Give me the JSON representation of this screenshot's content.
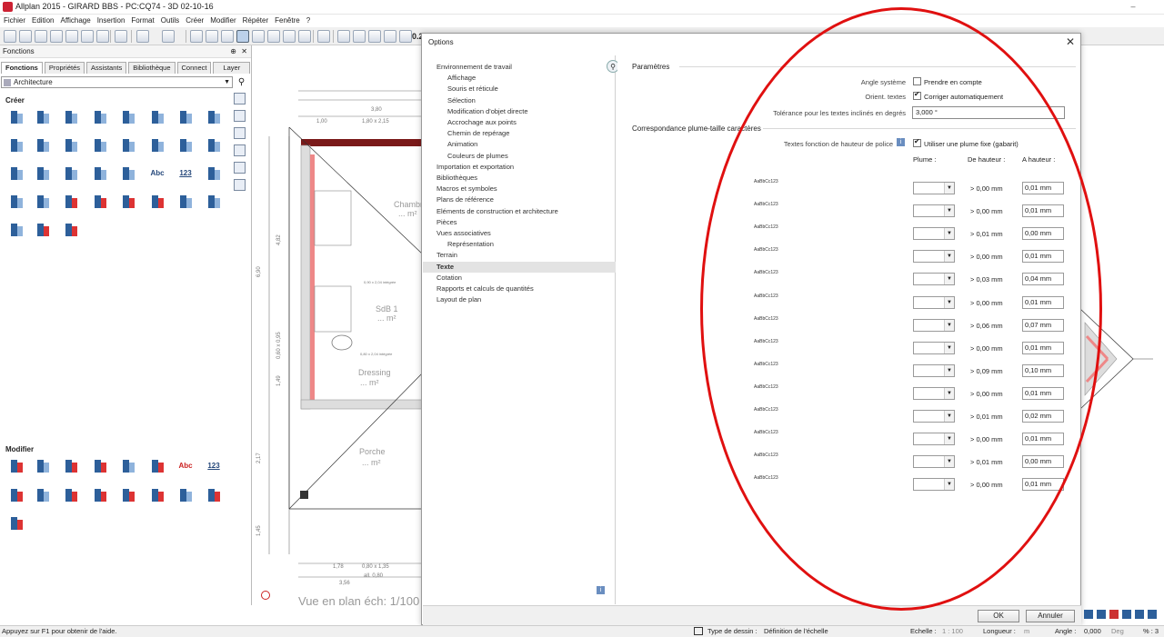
{
  "window": {
    "title": "Allplan 2015 - GIRARD BBS - PC:CQ74 - 3D 02-10-16",
    "minimize": "–"
  },
  "menu": [
    "Fichier",
    "Edition",
    "Affichage",
    "Insertion",
    "Format",
    "Outils",
    "Créer",
    "Modifier",
    "Répéter",
    "Fenêtre",
    "?"
  ],
  "toolbar": {
    "value_partial": "0.2"
  },
  "left_panel": {
    "title": "Fonctions",
    "pin": "⊕",
    "close": "✕",
    "tabs": [
      "Fonctions",
      "Propriétés",
      "Assistants",
      "Bibliothèque",
      "Connect",
      "Layer"
    ],
    "active_tab": "Fonctions",
    "module_select": "Architecture",
    "section_create": "Créer",
    "section_modify": "Modifier",
    "text_tool": "Abc",
    "number_tool": "123"
  },
  "drawing": {
    "dims_top": [
      "3,80",
      "1,00",
      "1,80 x 2,15"
    ],
    "dims_left": [
      "6,90",
      "4,82",
      "0,60 x 0,95",
      "1,49",
      "2,17",
      "1,45"
    ],
    "dims_bottom": [
      "1,78",
      "0,80 x 1,35",
      "all. 0,80",
      "3,56"
    ],
    "rooms": [
      {
        "name": "Chambre",
        "area": "... m²"
      },
      {
        "name": "SdB 1",
        "area": "... m²"
      },
      {
        "name": "Dressing",
        "area": "... m²"
      },
      {
        "name": "Porche",
        "area": "... m²"
      }
    ],
    "door_labels": [
      "0,90 x 2,04 intégrée",
      "0,80 x 2,04 intégrée"
    ],
    "caption": "Vue en plan éch: 1/100"
  },
  "dialog": {
    "title": "Options",
    "close": "✕",
    "tree": [
      {
        "label": "Environnement de travail",
        "level": 0
      },
      {
        "label": "Affichage",
        "level": 1
      },
      {
        "label": "Souris et réticule",
        "level": 1
      },
      {
        "label": "Sélection",
        "level": 1
      },
      {
        "label": "Modification d'objet directe",
        "level": 1
      },
      {
        "label": "Accrochage aux points",
        "level": 1
      },
      {
        "label": "Chemin de repérage",
        "level": 1
      },
      {
        "label": "Animation",
        "level": 1
      },
      {
        "label": "Couleurs de plumes",
        "level": 1
      },
      {
        "label": "Importation et exportation",
        "level": 0
      },
      {
        "label": "Bibliothèques",
        "level": 0
      },
      {
        "label": "Macros et symboles",
        "level": 0
      },
      {
        "label": "Plans de référence",
        "level": 0
      },
      {
        "label": "Eléments de construction et architecture",
        "level": 0
      },
      {
        "label": "Pièces",
        "level": 0
      },
      {
        "label": "Vues associatives",
        "level": 0
      },
      {
        "label": "Représentation",
        "level": 1
      },
      {
        "label": "Terrain",
        "level": 0
      },
      {
        "label": "Texte",
        "level": 0,
        "selected": true
      },
      {
        "label": "Cotation",
        "level": 0
      },
      {
        "label": "Rapports et calculs de quantités",
        "level": 0
      },
      {
        "label": "Layout de plan",
        "level": 0
      }
    ],
    "params": {
      "heading": "Paramètres",
      "system_angle_label": "Angle système",
      "system_angle_check": "Prendre en compte",
      "system_angle_checked": false,
      "orient_label": "Orient. textes",
      "orient_check": "Corriger automatiquement",
      "orient_checked": true,
      "tolerance_label": "Tolérance pour les textes inclinés en degrés",
      "tolerance_value": "3,000 °"
    },
    "pen_map": {
      "heading": "Correspondance plume-taille caractères",
      "font_height_label": "Textes fonction de hauteur de police",
      "fixed_pen_check": "Utiliser une plume fixe (gabarit)",
      "fixed_pen_checked": true,
      "col_pen": "Plume :",
      "col_from": "De hauteur :",
      "col_to": "A hauteur :",
      "rows": [
        {
          "sample": "AaBbCc123",
          "from": "> 0,00 mm",
          "to": "0,01 mm"
        },
        {
          "sample": "AaBbCc123",
          "from": "> 0,00 mm",
          "to": "0,01 mm"
        },
        {
          "sample": "AaBbCc123",
          "from": "> 0,01 mm",
          "to": "0,00 mm"
        },
        {
          "sample": "AaBbCc123",
          "from": "> 0,00 mm",
          "to": "0,01 mm"
        },
        {
          "sample": "AaBbCc123",
          "from": "> 0,03 mm",
          "to": "0,04 mm"
        },
        {
          "sample": "AaBbCc123",
          "from": "> 0,00 mm",
          "to": "0,01 mm"
        },
        {
          "sample": "AaBbCc123",
          "from": "> 0,06 mm",
          "to": "0,07 mm"
        },
        {
          "sample": "AaBbCc123",
          "from": "> 0,00 mm",
          "to": "0,01 mm"
        },
        {
          "sample": "AaBbCc123",
          "from": "> 0,09 mm",
          "to": "0,10 mm"
        },
        {
          "sample": "AaBbCc123",
          "from": "> 0,00 mm",
          "to": "0,01 mm"
        },
        {
          "sample": "AaBbCc123",
          "from": "> 0,01 mm",
          "to": "0,02 mm"
        },
        {
          "sample": "AaBbCc123",
          "from": "> 0,00 mm",
          "to": "0,01 mm"
        },
        {
          "sample": "AaBbCc123",
          "from": "> 0,01 mm",
          "to": "0,00 mm"
        },
        {
          "sample": "AaBbCc123",
          "from": "> 0,00 mm",
          "to": "0,01 mm"
        }
      ]
    },
    "ok": "OK",
    "cancel": "Annuler"
  },
  "statusbar": {
    "help": "Appuyez sur F1 pour obtenir de l'aide.",
    "drawing_type_label": "Type de dessin :",
    "drawing_type_value": "Définition de l'échelle",
    "scale_label": "Echelle :",
    "scale_value": "1 : 100",
    "length_label": "Longueur :",
    "length_unit": "m",
    "angle_label": "Angle :",
    "angle_value": "0,000",
    "angle_unit": "Deg",
    "percent": "% : 3"
  },
  "colors": {
    "annotation": "#e01010",
    "wall_hatch": "#e88",
    "icon_blue": "#2d5f9a"
  }
}
